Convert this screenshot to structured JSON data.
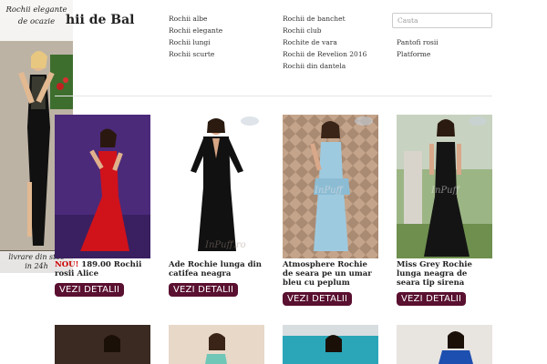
{
  "header": {
    "site_title": "hii de Bal"
  },
  "nav": {
    "col1": [
      "Rochii albe",
      "Rochii elegante",
      "Rochii lungi",
      "Rochii scurte"
    ],
    "col2": [
      "Rochii de banchet",
      "Rochii club",
      "Rochite de vara",
      "Rochii de Revelion 2016",
      "Rochii din dantela"
    ],
    "col3": [
      "Pantofi rosii",
      "Platforme"
    ]
  },
  "search": {
    "placeholder": "Cauta"
  },
  "side_banner": {
    "title_line1": "Rochii elegante",
    "title_line2": "de ocazie",
    "caption_line1": "livrare din stoc",
    "caption_line2": "in 24h"
  },
  "products": [
    {
      "badge": "NOU!",
      "name": " 189.00 Rochii rosii Alice",
      "button": "VEZI DETALII"
    },
    {
      "name": "Ade Rochie lunga din catifea neagra",
      "button": "VEZI DETALII",
      "watermark": "InPuff.ro"
    },
    {
      "name": "Atmosphere Rochie de seara pe un umar bleu cu peplum",
      "button": "VEZI DETALII",
      "watermark": "InPuff"
    },
    {
      "name": "Miss Grey Rochie lunga neagra de seara tip sirena",
      "button": "VEZI DETALII",
      "watermark": "InPuff"
    }
  ],
  "colors": {
    "button_bg": "#5a1030",
    "new_badge": "#cc0000"
  }
}
